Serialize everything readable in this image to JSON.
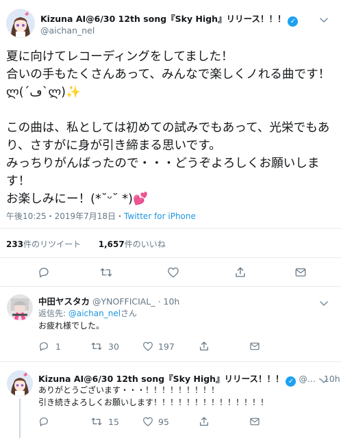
{
  "main_tweet": {
    "display_name": "Kizuna AI@6/30 12th song『Sky High』リリース！！！",
    "handle": "@aichan_nel",
    "body": "夏に向けてレコーディングをしてました！\n合いの手もたくさんあって、みんなで楽しくノれる曲です！ლ(´ڡ`ლ)✨\n\nこの曲は、私としては初めての試みでもあって、光栄でもあり、さすがに身が引き締まる思いです。\nみっちりがんばったので・・・どうぞよろしくお願いします！\nお楽しみにー！(*˘ᵕ˘ *)💕",
    "timestamp": "午後10:25・2019年7月18日・",
    "source": "Twitter for iPhone",
    "retweet_count": "233",
    "retweet_label": "件のリツイート",
    "like_count": "1,657",
    "like_label": "件のいいね"
  },
  "replies": [
    {
      "display_name": "中田ヤスタカ",
      "handle": "@YNOFFICIAL_",
      "time": "· 10h",
      "replying_prefix": "返信先: ",
      "replying_handle": "@aichan_nel",
      "replying_suffix": "さん",
      "body": "お疲れ様でした。",
      "reply_count": "1",
      "retweet_count": "30",
      "like_count": "197"
    },
    {
      "display_name": "Kizuna AI@6/30 12th song『Sky High』リリース！！！",
      "handle": "@...",
      "time": "· 10h",
      "body": "ありがとうございます・・・！！！！！！！！！\n引き続きよろしくお願いします！！！！！！！！！！！！！！",
      "reply_count": "",
      "retweet_count": "15",
      "like_count": "95"
    }
  ],
  "colors": {
    "accent": "#1da1f2",
    "link": "#1b95e0",
    "muted": "#657786",
    "heart": "#e0245e",
    "sparkle": "#ffcc4d"
  }
}
